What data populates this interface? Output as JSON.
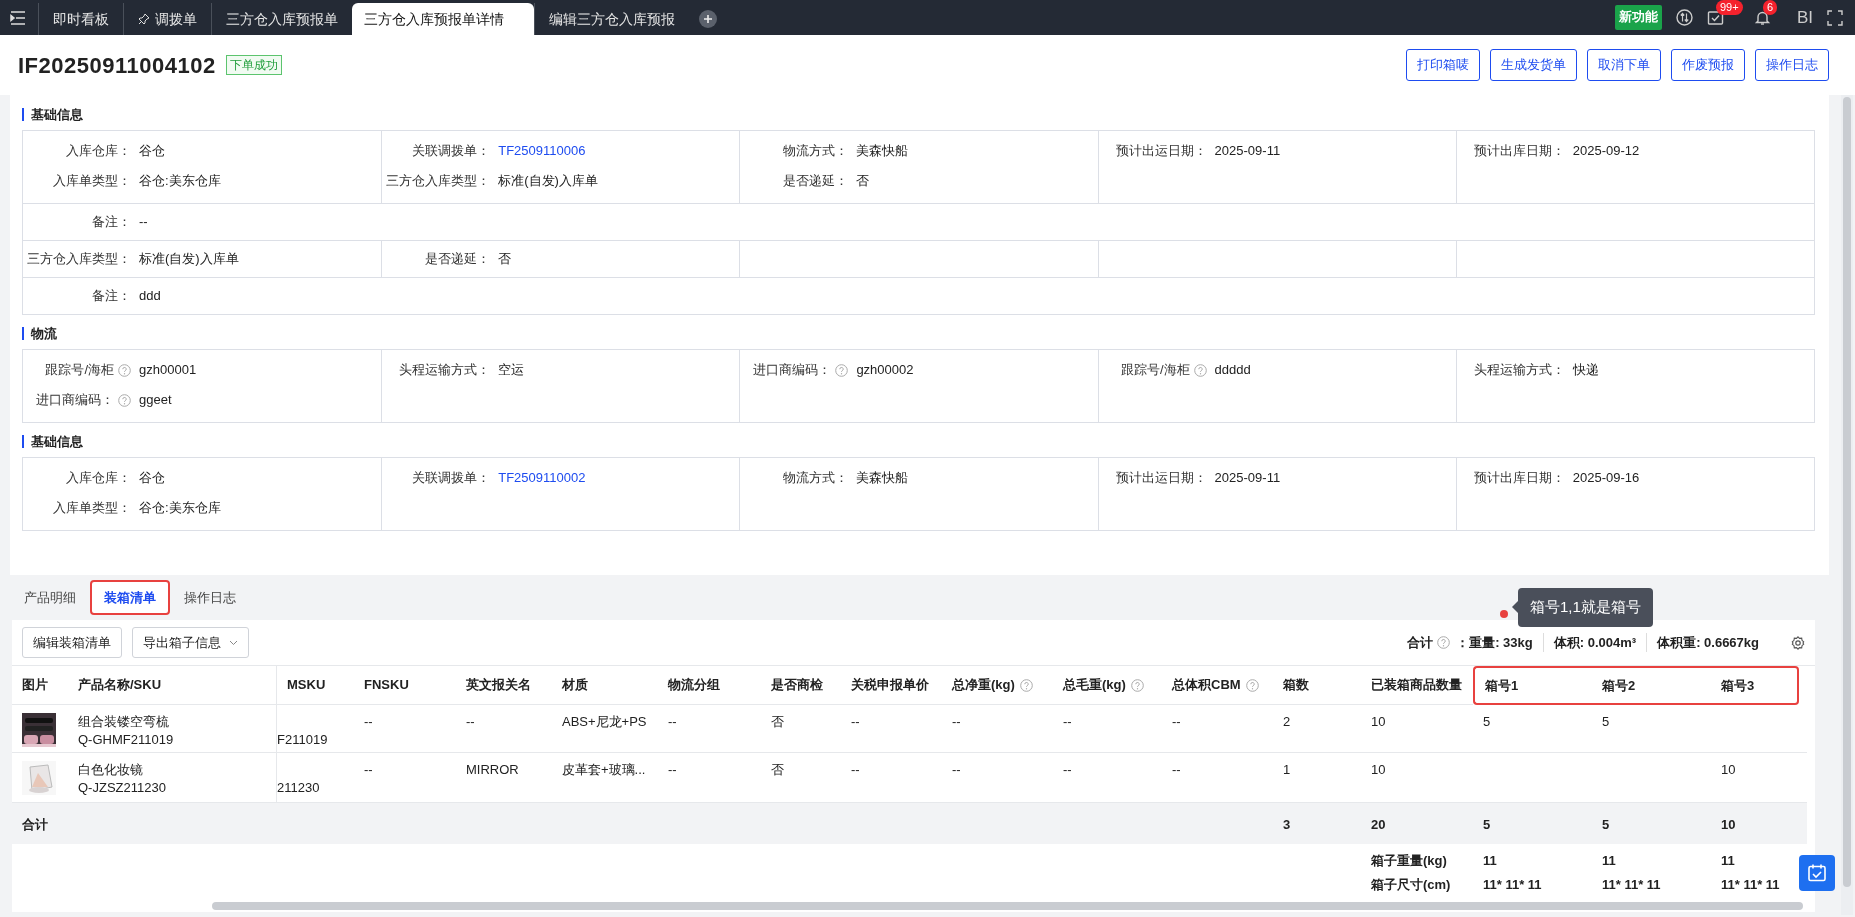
{
  "topbar": {
    "tabs": [
      {
        "label": "即时看板",
        "selected": false
      },
      {
        "label": "调拨单",
        "selected": false,
        "pinned": true
      },
      {
        "label": "三方仓入库预报单",
        "selected": false
      },
      {
        "label": "三方仓入库预报单详情",
        "selected": true
      },
      {
        "label": "编辑三方仓入库预报",
        "selected": false
      }
    ],
    "new_feature": "新功能",
    "task_badge": "99+",
    "bell_badge": "6",
    "bi": "BI"
  },
  "header": {
    "title": "IF20250911004102",
    "status": "下单成功",
    "buttons": [
      "打印箱唛",
      "生成发货单",
      "取消下单",
      "作废预报",
      "操作日志"
    ]
  },
  "sections": [
    {
      "title": "基础信息",
      "rows": [
        {
          "kind": "columns",
          "cells": [
            [
              {
                "label": "入库仓库：",
                "value": "谷仓"
              },
              {
                "label": "入库单类型：",
                "value": "谷仓:美东仓库"
              }
            ],
            [
              {
                "label": "关联调拨单：",
                "value": "TF2509110006",
                "link": true
              },
              {
                "label": "三方仓入库类型：",
                "value": "标准(自发)入库单"
              }
            ],
            [
              {
                "label": "物流方式：",
                "value": "美森快船"
              },
              {
                "label": "是否递延：",
                "value": "否"
              }
            ],
            [
              {
                "label": "预计出运日期：",
                "value": "2025-09-11"
              }
            ],
            [
              {
                "label": "预计出库日期：",
                "value": "2025-09-12"
              }
            ]
          ]
        },
        {
          "kind": "full",
          "fields": [
            {
              "label": "备注：",
              "value": "--"
            }
          ]
        },
        {
          "kind": "columns",
          "cells": [
            [
              {
                "label": "三方仓入库类型：",
                "value": "标准(自发)入库单"
              }
            ],
            [
              {
                "label": "是否递延：",
                "value": "否"
              }
            ]
          ]
        },
        {
          "kind": "full",
          "fields": [
            {
              "label": "备注：",
              "value": "ddd"
            }
          ]
        }
      ]
    },
    {
      "title": "物流",
      "rows": [
        {
          "kind": "columns",
          "cells": [
            [
              {
                "label": "跟踪号/海柜",
                "value": "gzh00001",
                "help": true
              },
              {
                "label": "进口商编码：",
                "value": "ggeet",
                "help": true
              }
            ],
            [
              {
                "label": "头程运输方式：",
                "value": "空运"
              }
            ],
            [
              {
                "label": "进口商编码：",
                "value": "gzh00002",
                "help": true
              }
            ],
            [
              {
                "label": "跟踪号/海柜",
                "value": "ddddd",
                "help": true
              }
            ],
            [
              {
                "label": "头程运输方式：",
                "value": "快递"
              }
            ]
          ]
        }
      ]
    },
    {
      "title": "基础信息",
      "rows": [
        {
          "kind": "columns",
          "cells": [
            [
              {
                "label": "入库仓库：",
                "value": "谷仓"
              },
              {
                "label": "入库单类型：",
                "value": "谷仓:美东仓库"
              }
            ],
            [
              {
                "label": "关联调拨单：",
                "value": "TF2509110002",
                "link": true
              }
            ],
            [
              {
                "label": "物流方式：",
                "value": "美森快船"
              }
            ],
            [
              {
                "label": "预计出运日期：",
                "value": "2025-09-11"
              }
            ],
            [
              {
                "label": "预计出库日期：",
                "value": "2025-09-16"
              }
            ]
          ]
        }
      ]
    }
  ],
  "detail_tabs": [
    {
      "label": "产品明细",
      "selected": false
    },
    {
      "label": "装箱清单",
      "selected": true,
      "highlighted": true
    },
    {
      "label": "操作日志",
      "selected": false
    }
  ],
  "toolbar": {
    "buttons": [
      {
        "label": "编辑装箱清单"
      },
      {
        "label": "导出箱子信息",
        "dropdown": true
      }
    ],
    "summary_label": "合计",
    "summary_items": [
      "：重量: 33kg",
      "体积: 0.004m³",
      "体积重: 0.6667kg"
    ]
  },
  "tooltip": {
    "text": "箱号1,1就是箱号"
  },
  "table": {
    "columns": [
      {
        "label": "图片"
      },
      {
        "label": "产品名称/SKU"
      },
      {
        "label": "MSKU"
      },
      {
        "label": "FNSKU"
      },
      {
        "label": "英文报关名"
      },
      {
        "label": "材质"
      },
      {
        "label": "物流分组"
      },
      {
        "label": "是否商检"
      },
      {
        "label": "关税申报单价"
      },
      {
        "label": "总净重(kg)",
        "help": true
      },
      {
        "label": "总毛重(kg)",
        "help": true
      },
      {
        "label": "总体积CBM",
        "help": true
      },
      {
        "label": "箱数"
      },
      {
        "label": "已装箱商品数量"
      },
      {
        "label": "箱号1",
        "highlighted": true
      },
      {
        "label": "箱号2",
        "highlighted": true
      },
      {
        "label": "箱号3",
        "highlighted": true
      }
    ],
    "rows": [
      {
        "sku": "Q-GHMF211019",
        "cells": [
          "",
          "组合装镂空弯梳",
          "F211019",
          "--",
          "--",
          "ABS+尼龙+PS",
          "--",
          "否",
          "--",
          "--",
          "--",
          "--",
          "2",
          "10",
          "5",
          "5",
          ""
        ]
      },
      {
        "sku": "Q-JZSZ211230",
        "cells": [
          "",
          "白色化妆镜",
          "211230",
          "--",
          "MIRROR",
          "皮革套+玻璃...",
          "--",
          "否",
          "--",
          "--",
          "--",
          "--",
          "1",
          "10",
          "",
          "",
          "10"
        ]
      }
    ],
    "totals": {
      "label": "合计",
      "values": [
        "3",
        "20",
        "5",
        "5",
        "10"
      ]
    },
    "box_info": [
      {
        "label": "箱子重量(kg)",
        "values": [
          "11",
          "11",
          "11"
        ]
      },
      {
        "label": "箱子尺寸(cm)",
        "values": [
          "11* 11* 11",
          "11* 11* 11",
          "11* 11* 11"
        ]
      }
    ]
  }
}
